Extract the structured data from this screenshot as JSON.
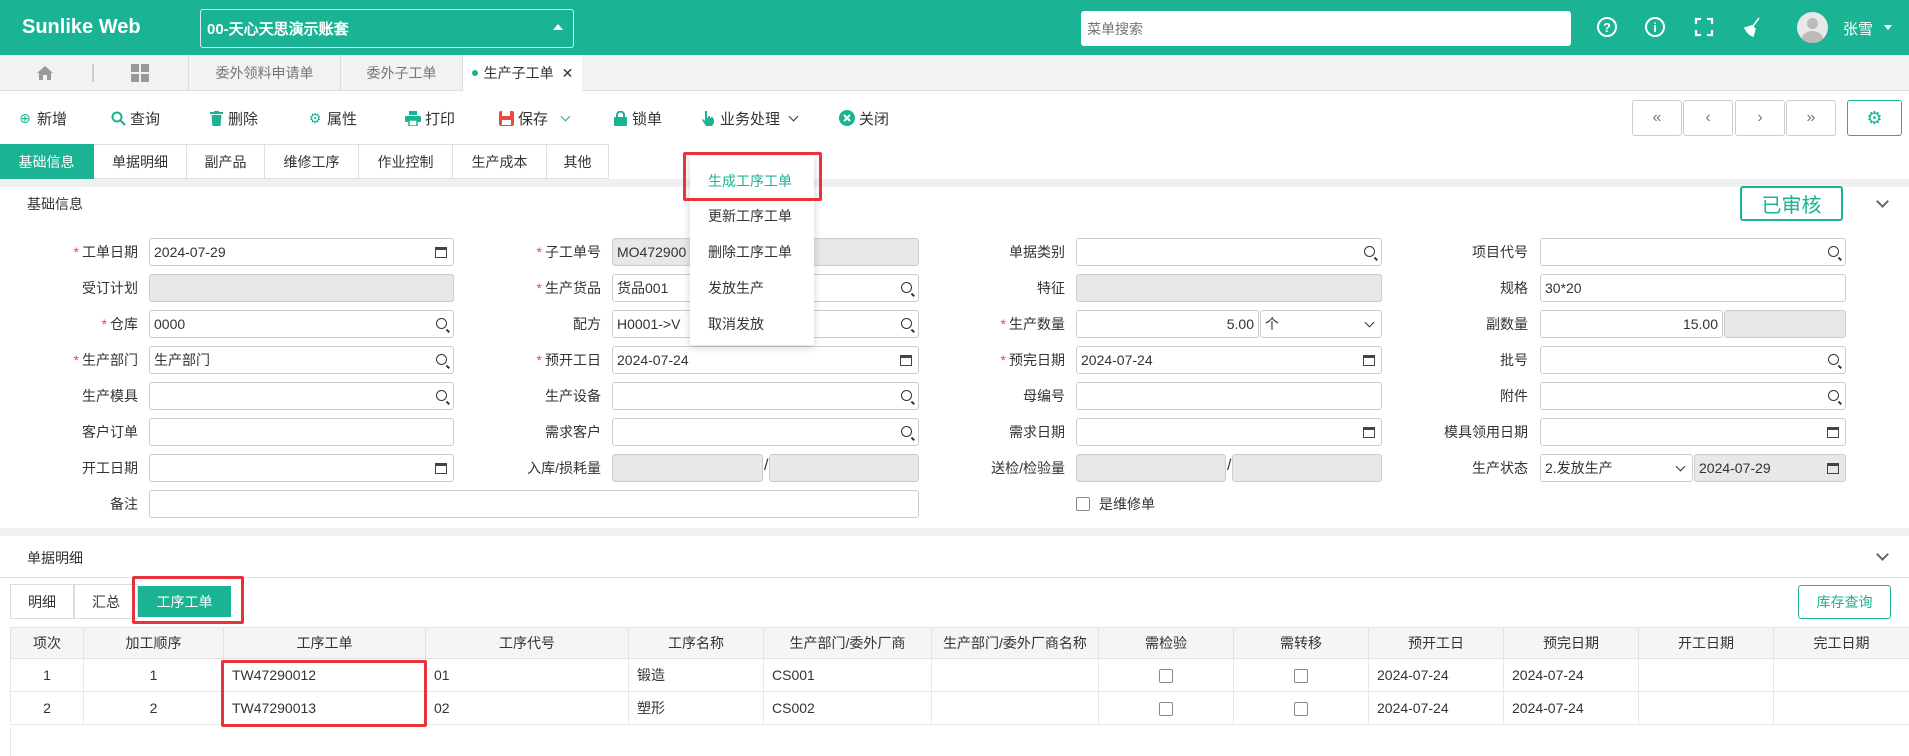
{
  "app": {
    "brand": "Sunlike Web",
    "account": "00-天心天思演示账套",
    "search_placeholder": "菜单搜索",
    "user": "张雪"
  },
  "tabs": [
    "委外领料申请单",
    "委外子工单",
    "生产子工单"
  ],
  "toolbar": {
    "add": "新增",
    "query": "查询",
    "delete": "删除",
    "props": "属性",
    "print": "打印",
    "save": "保存",
    "lock": "锁单",
    "biz": "业务处理",
    "close": "关闭"
  },
  "sectabs": [
    "基础信息",
    "单据明细",
    "副产品",
    "维修工序",
    "作业控制",
    "生产成本",
    "其他"
  ],
  "basic": {
    "title": "基础信息",
    "status": "已审核"
  },
  "menu": [
    "生成工序工单",
    "更新工序工单",
    "删除工序工单",
    "发放生产",
    "取消发放"
  ],
  "form": {
    "l_date": "工单日期",
    "v_date": "2024-07-29",
    "l_sub": "子工单号",
    "v_sub": "MO472900",
    "l_type": "单据类别",
    "l_proj": "项目代号",
    "l_plan": "受订计划",
    "l_goods": "生产货品",
    "v_goods": "货品001",
    "l_feat": "特征",
    "l_spec": "规格",
    "v_spec": "30*20",
    "l_wh": "仓库",
    "v_wh": "0000",
    "l_formula": "配方",
    "v_formula": "H0001->V",
    "l_qty": "生产数量",
    "v_qty": "5.00",
    "v_unit": "个",
    "l_subqty": "副数量",
    "v_subqty": "15.00",
    "l_dept": "生产部门",
    "v_dept": "生产部门",
    "l_pstart": "预开工日",
    "v_pstart": "2024-07-24",
    "l_pend": "预完日期",
    "v_pend": "2024-07-24",
    "l_batch": "批号",
    "l_mold": "生产模具",
    "l_equip": "生产设备",
    "l_parent": "母编号",
    "l_attach": "附件",
    "l_cust": "客户订单",
    "l_reqcust": "需求客户",
    "l_reqdate": "需求日期",
    "l_molddate": "模具领用日期",
    "l_start": "开工日期",
    "l_inloss": "入库/损耗量",
    "l_check": "送检/检验量",
    "l_state": "生产状态",
    "v_state": "2.发放生产",
    "v_statedate": "2024-07-29",
    "l_note": "备注",
    "l_repair": "是维修单"
  },
  "detail": {
    "title": "单据明细",
    "tabs": [
      "明细",
      "汇总",
      "工序工单"
    ],
    "stock_btn": "库存查询",
    "columns": [
      "项次",
      "加工顺序",
      "工序工单",
      "工序代号",
      "工序名称",
      "生产部门/委外厂商",
      "生产部门/委外厂商名称",
      "需检验",
      "需转移",
      "预开工日",
      "预完日期",
      "开工日期",
      "完工日期"
    ],
    "rows": [
      {
        "no": "1",
        "seq": "1",
        "wo": "TW47290012",
        "code": "01",
        "name": "锻造",
        "dept": "CS001",
        "deptname": "",
        "start": "2024-07-24",
        "end": "2024-07-24"
      },
      {
        "no": "2",
        "seq": "2",
        "wo": "TW47290013",
        "code": "02",
        "name": "塑形",
        "dept": "CS002",
        "deptname": "",
        "start": "2024-07-24",
        "end": "2024-07-24"
      }
    ]
  },
  "colors": {
    "accent": "#1ab394",
    "highlight": "#e8323c"
  }
}
